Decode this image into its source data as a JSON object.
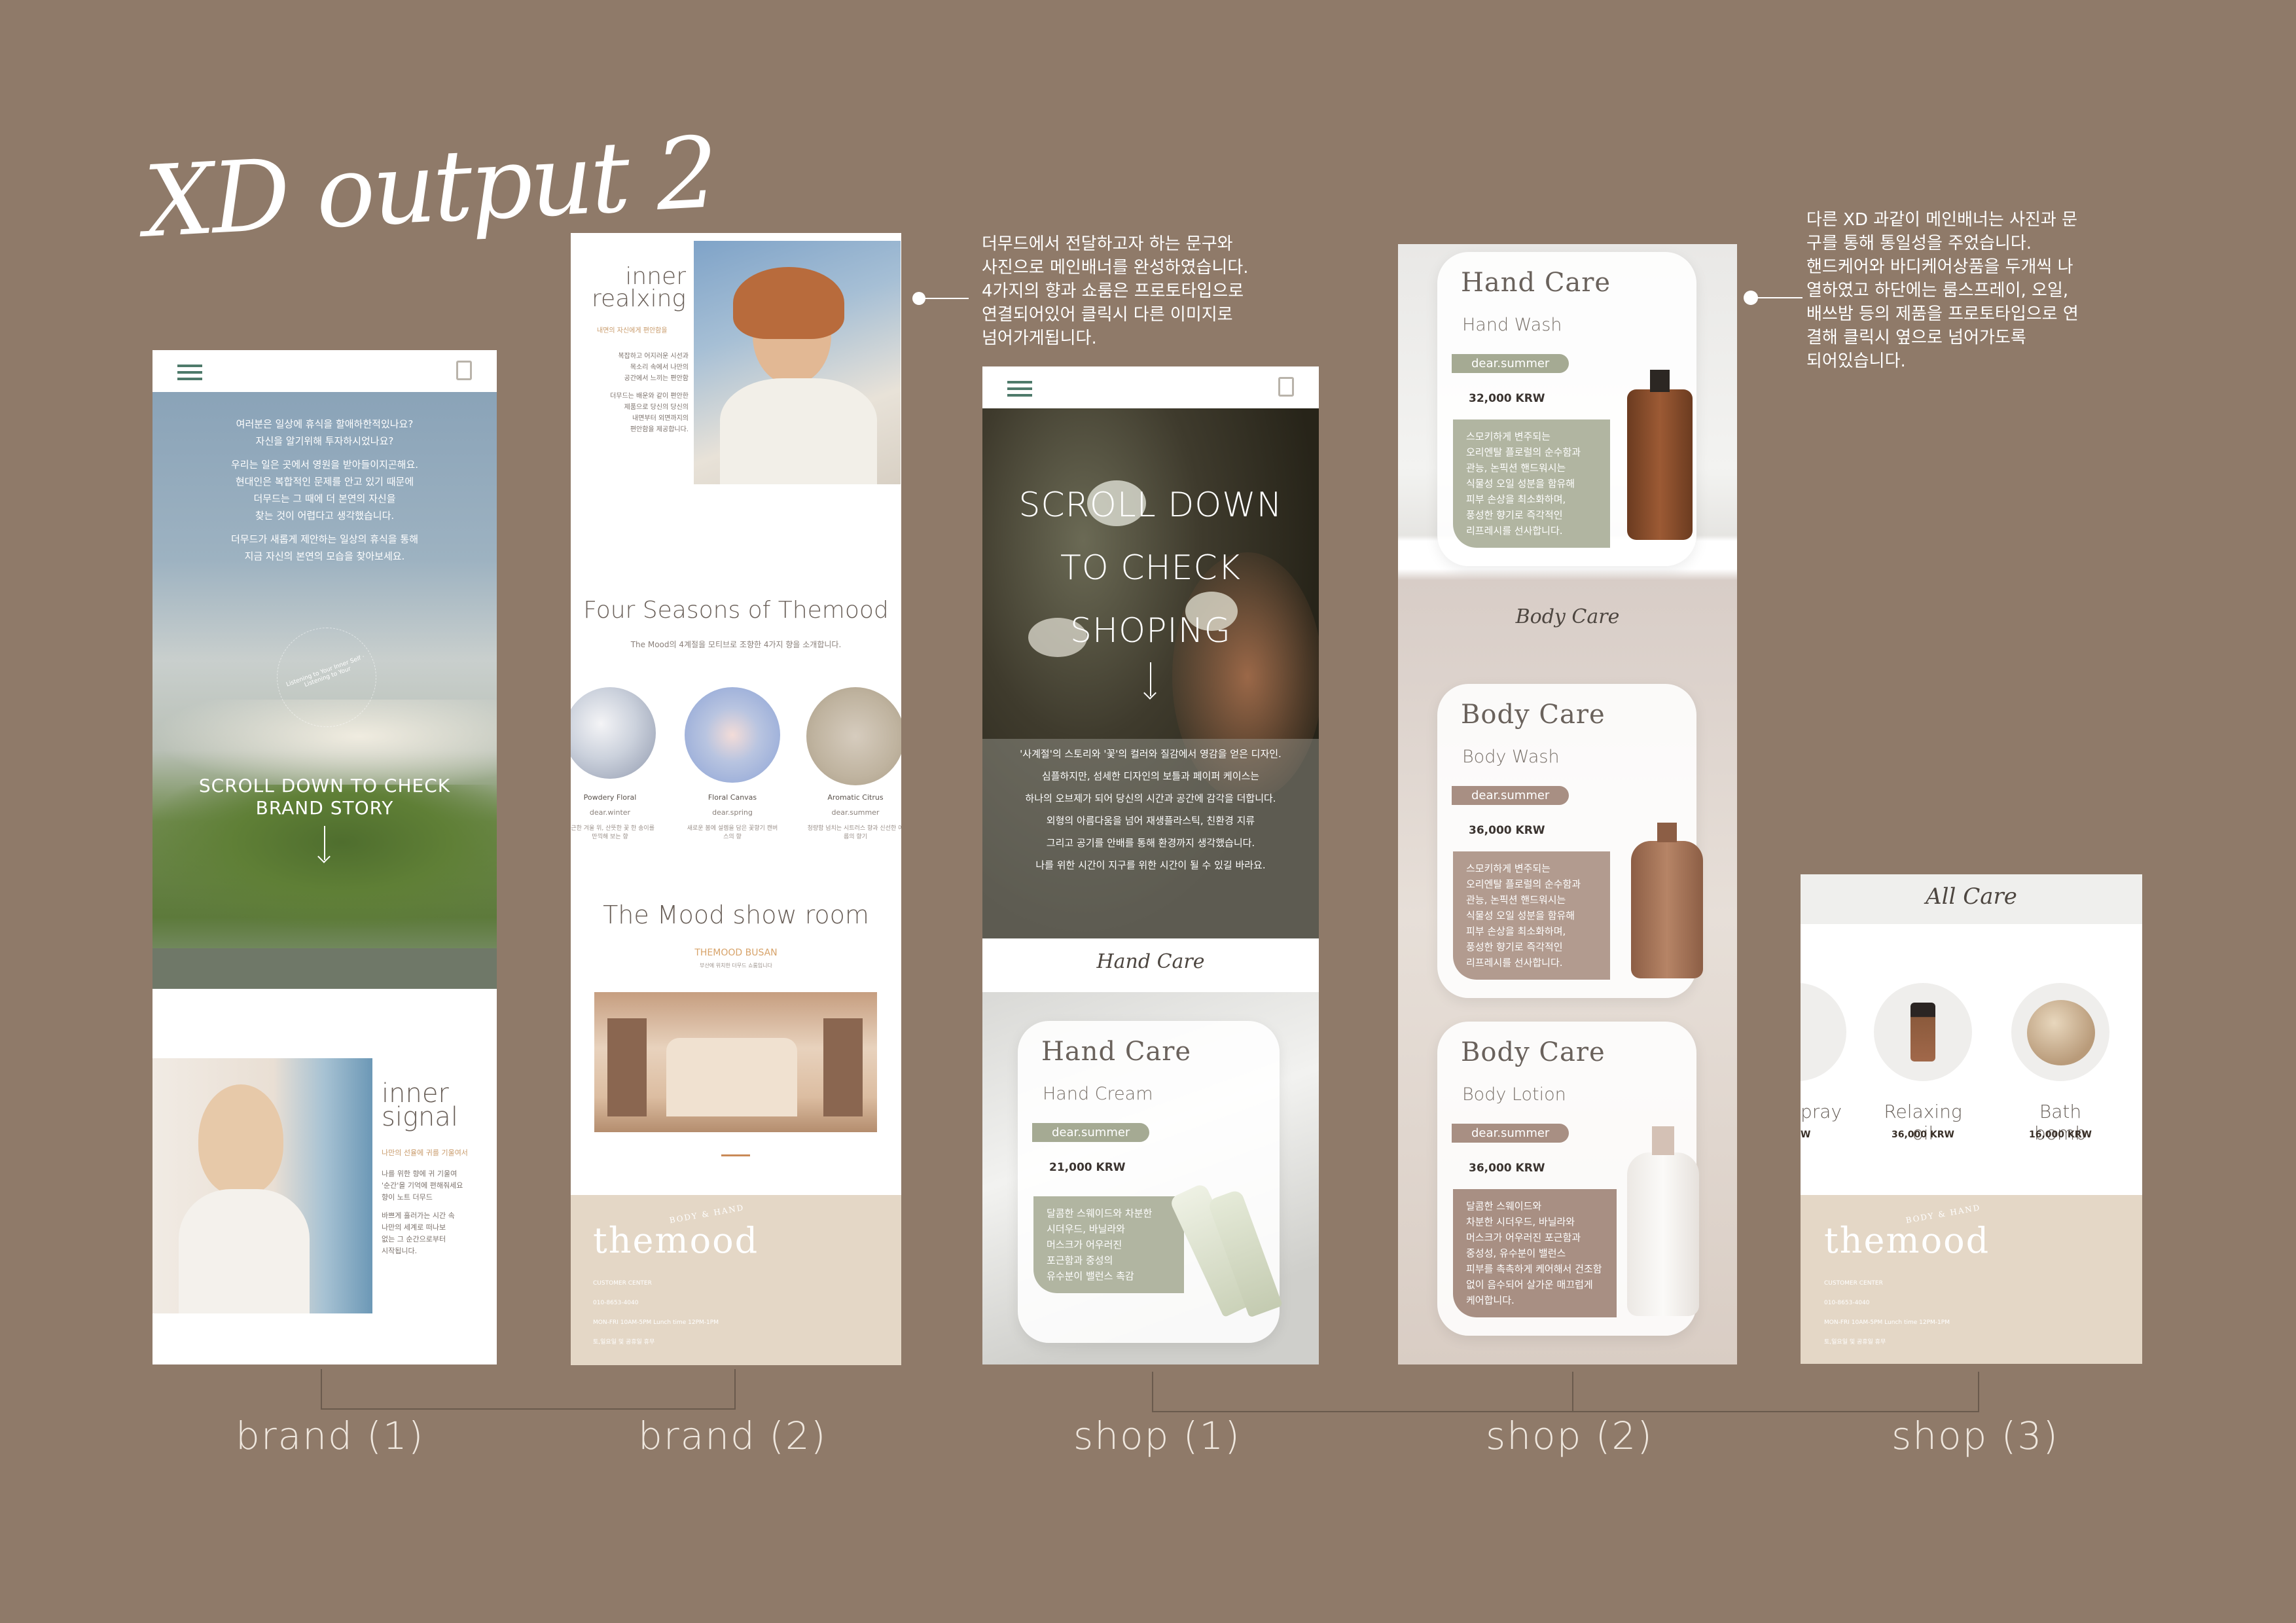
{
  "page": {
    "title": "XD output 2"
  },
  "notes": {
    "shop1": [
      "더무드에서  전달하고자 하는 문구와",
      "사진으로 메인배너를 완성하였습니다.",
      "4가지의 향과 쇼룸은 프로토타입으로",
      "연결되어있어  클릭시 다른 이미지로",
      "넘어가게됩니다."
    ],
    "shop2": [
      "다른 XD 과같이 메인배너는 사진과 문",
      "구를 통해 통일성을 주었습니다.",
      "핸드케어와 바디케어상품을 두개씩 나",
      "열하였고 하단에는 룸스프레이, 오일,",
      "배쓰밤 등의 제품을 프로토타입으로 연",
      "결해 클릭시 옆으로 넘어가도록",
      "되어있습니다."
    ]
  },
  "captions": {
    "brand1": "brand (1)",
    "brand2": "brand (2)",
    "shop1": "shop (1)",
    "shop2": "shop (2)",
    "shop3": "shop (3)"
  },
  "brand1": {
    "intro": [
      "여러분은 일상에 휴식을 할애하한적있나요?",
      "자신을 알기위해 투자하시었나요?",
      "",
      "우리는 일은 곳에서 영원을 받아들이지곤해요.",
      "현대인은 복합적인 문제를 안고 있기 때문에",
      "더무드는 그 때에 더 본연의 자신을",
      "찾는 것이 어렵다고 생각했습니다.",
      "",
      "더무드가 새롭게 제안하는 일상의 휴식을 통해",
      "지금 자신의 본연의 모습을 찾아보세요."
    ],
    "circle_text": "Listening to Your Inner Self · Listening to Your",
    "scroll_line1": "SCROLL DOWN TO CHECK",
    "scroll_line2": "BRAND STORY",
    "inner_title1": "inner",
    "inner_title2": "signal",
    "inner_accent": "나만의 선율에 귀를 기울여서",
    "inner_body": [
      "나를 위한 향에 귀 기울여",
      "'순간'을 기억에 편해줘세요",
      "향이 노트 더무드",
      "",
      "바쁘게 흘러가는 시간 속",
      "나만의 세계로 떠나보",
      "없는 그 순간으로부터",
      "시작됩니다."
    ]
  },
  "brand2": {
    "inner_title1": "inner",
    "inner_title2": "realxing",
    "inner_accent": "내면의 자신에게 편안함을",
    "inner_body": [
      "복잡하고 어지러운 시선과",
      "목소리 속에서 나만의",
      "공간에서 느끼는 편안함",
      "",
      "더무드는 배운와 같이 편안한",
      "제품으로 당신의 당신의",
      "내면부터 외면까지의",
      "편안함을 제공합니다."
    ],
    "seasons_title": "Four Seasons of Themood",
    "seasons_sub": "The Mood의 4계절을 모티브로 조향한 4가지 향을 소개합니다.",
    "seasons": [
      {
        "name": "Powdery Floral",
        "tag": "dear.winter",
        "desc": "포근한 겨울 위, 산뜻한 꽃 한 송이를 만끽해 보는 향"
      },
      {
        "name": "Floral Canvas",
        "tag": "dear.spring",
        "desc": "새로운 봄에 설렘을 담은 꽃향기 캔버스의 향"
      },
      {
        "name": "Aromatic Citrus",
        "tag": "dear.summer",
        "desc": "청량함 넘치는 시트러스 향과 신선한 여름의 향기"
      }
    ],
    "showroom_title": "The Mood show room",
    "showroom_sub": "THEMOOD BUSAN",
    "showroom_small": "부산에 위치한 더무드 쇼룸입니다",
    "footer": {
      "logo": "themood",
      "logo_small": "BODY & HAND",
      "line1": "CUSTOMER CENTER",
      "line2": "010-8653-4040",
      "line3": "MON-FRI 10AM-5PM  Lunch time 12PM-1PM",
      "line4": "토,일요일 및 공휴일 휴무"
    }
  },
  "shop1": {
    "scroll_lines": [
      "SCROLL DOWN",
      "TO CHECK",
      "SHOPING"
    ],
    "overlay": [
      "'사계절'의 스토리와 '꽃'의 컬러와 질감에서 영감을 얻은 디자인.",
      "",
      "심플하지만, 섬세한 디자인의 보틀과 페이퍼 케이스는",
      "하나의 오브제가 되어 당신의 시간과 공간에 감각을 더합니다.",
      "",
      "외형의 아름다움을 넘어 재생플라스틱, 친환경 지류",
      "그리고 공기를 안배를 통해 환경까지 생각했습니다.",
      "나를 위한 시간이 지구를 위한 시간이 될 수 있길 바라요."
    ],
    "section": "Hand Care",
    "card": {
      "title": "Hand Care",
      "sub": "Hand Cream",
      "tag": "dear.summer",
      "price": "21,000 KRW",
      "desc": [
        "달콤한 스웨이드와 차분한",
        "시더우드, 바닐라와",
        "머스크가 어우러진",
        "포근함과 중성의",
        "유수분이 밸런스 촉감"
      ]
    }
  },
  "shop2": {
    "cards": [
      {
        "title": "Hand Care",
        "sub": "Hand Wash",
        "tag": "dear.summer",
        "price": "32,000 KRW",
        "desc": [
          "스모키하게 변주되는",
          "오리엔탈 플로럴의 순수함과",
          "관능, 논픽션 핸드워시는",
          "식물성 오일 성분을 함유해",
          "피부 손상을 최소화하며,",
          "풍성한 향기로 즉각적인",
          "리프레시를 선사합니다."
        ]
      },
      {
        "title": "Body Care",
        "sub": "Body Wash",
        "tag": "dear.summer",
        "price": "36,000 KRW",
        "desc": [
          "스모키하게 변주되는",
          "오리엔탈 플로럴의 순수함과",
          "관능, 논픽션 핸드워시는",
          "식물성 오일 성분을 함유해",
          "피부 손상을 최소화하며,",
          "풍성한 향기로 즉각적인",
          "리프레시를 선사합니다."
        ]
      },
      {
        "title": "Body Care",
        "sub": "Body Lotion",
        "tag": "dear.summer",
        "price": "36,000 KRW",
        "desc": [
          "달콤한 스웨이드와",
          "차분한 시더우드, 바닐라와",
          "머스크가 어우러진 포근함과",
          "중성성, 유수분이 밸런스",
          "피부를 촉촉하게 케어해서 건조함",
          "없이 음수되어 살가운 매끄럽게",
          "케어합니다."
        ]
      }
    ],
    "section": "Body Care"
  },
  "shop3": {
    "title": "All Care",
    "items": [
      {
        "name": "pray",
        "price": "W"
      },
      {
        "name": "Relaxing oil",
        "price": "36,000 KRW"
      },
      {
        "name": "Bath bomb",
        "price": "16,000 KRW"
      }
    ],
    "footer": {
      "logo": "themood",
      "logo_small": "BODY & HAND",
      "line1": "CUSTOMER CENTER",
      "line2": "010-8653-4040",
      "line3": "MON-FRI 10AM-5PM  Lunch time 12PM-1PM",
      "line4": "토,일요일 및 공휴일 휴무"
    }
  },
  "colors": {
    "background": "#8f7a69",
    "sage": "#a5aa93",
    "mauve": "#a88f83",
    "beige": "#e4d7c6",
    "menu": "#4e7a6a"
  }
}
